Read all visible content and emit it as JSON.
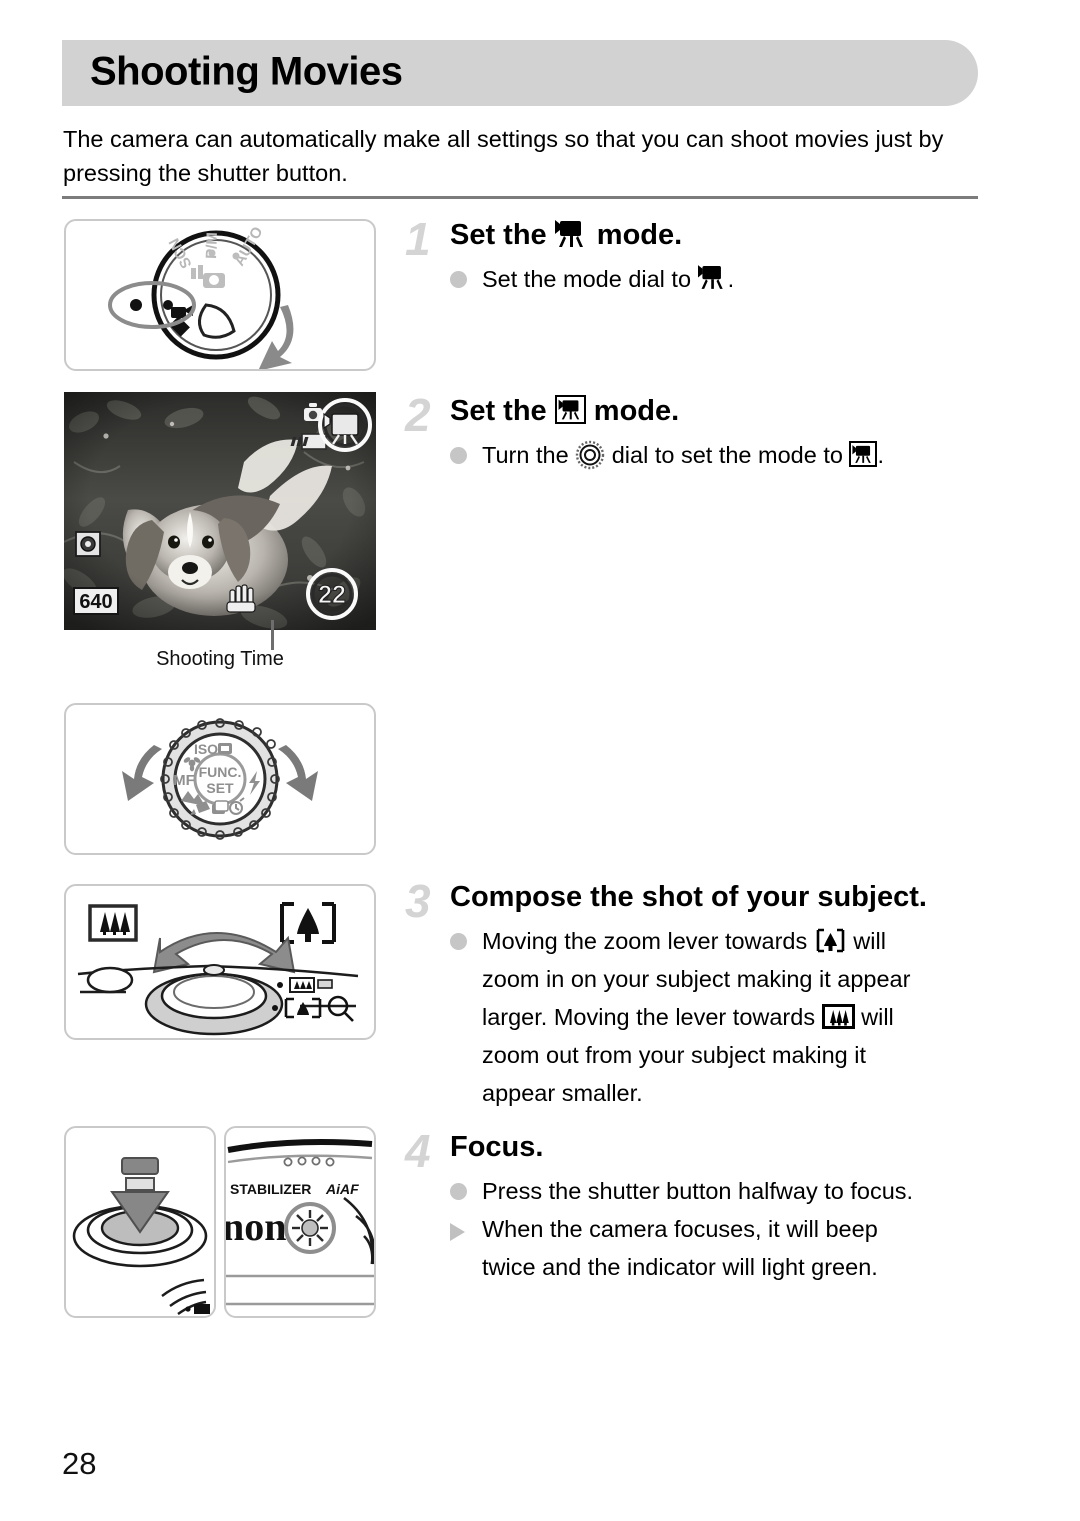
{
  "page": {
    "title": "Shooting Movies",
    "number": "28",
    "intro": "The camera can automatically make all settings so that you can shoot movies just by pressing the shutter button."
  },
  "figures": {
    "mode_dial": {
      "name": "mode-dial-illustration",
      "labels": [
        "AUTO",
        "P/M",
        "SCN"
      ],
      "highlight": "movie-mode-position"
    },
    "lcd": {
      "name": "lcd-preview",
      "caption": "Shooting Time",
      "overlays": {
        "resolution": "640",
        "shooting_time": "22",
        "mode_icon": "movie-mode-icon",
        "battery_icon": "battery-icon",
        "metering_icon": "metering-icon",
        "stabilizer_icon": "image-stabilizer-icon"
      }
    },
    "control_dial": {
      "name": "control-dial-illustration",
      "center_label_top": "FUNC.",
      "center_label_bottom": "SET",
      "labels": [
        "ISO",
        "MF"
      ]
    },
    "zoom_lever": {
      "name": "zoom-lever-illustration",
      "wide_icon": "wide-angle-icon",
      "tele_icon": "telephoto-icon"
    },
    "shutter": {
      "name": "shutter-button-illustration"
    },
    "af_lamp": {
      "name": "af-assist-lamp-illustration",
      "texts": [
        "STABILIZER",
        "AiAF",
        "non"
      ]
    }
  },
  "steps": [
    {
      "number": "1",
      "head_before": "Set the ",
      "head_icon": "movie-mode-icon",
      "head_after": " mode.",
      "lines": [
        {
          "marker": "dot",
          "before": "Set the mode dial to ",
          "icon": "movie-mode-icon",
          "after": "."
        }
      ]
    },
    {
      "number": "2",
      "head_before": "Set the ",
      "head_icon": "movie-mode-boxed-icon",
      "head_after": " mode.",
      "lines": [
        {
          "marker": "dot",
          "before": "Turn the ",
          "icon": "control-dial-icon",
          "mid": " dial to set the mode to ",
          "icon2": "movie-mode-boxed-icon",
          "after": "."
        }
      ]
    },
    {
      "number": "3",
      "head": "Compose the shot of your subject.",
      "lines": [
        {
          "marker": "dot",
          "before": "Moving the zoom lever towards ",
          "icon": "telephoto-icon",
          "after": " will"
        },
        {
          "marker": "none",
          "text": "zoom in on your subject making it appear"
        },
        {
          "marker": "none",
          "before": "larger. Moving the lever towards ",
          "icon": "wide-angle-icon",
          "after": " will"
        },
        {
          "marker": "none",
          "text": "zoom out from your subject making it"
        },
        {
          "marker": "none",
          "text": "appear smaller."
        }
      ]
    },
    {
      "number": "4",
      "head": "Focus.",
      "lines": [
        {
          "marker": "dot",
          "text": "Press the shutter button halfway to focus."
        },
        {
          "marker": "triangle",
          "text": "When the camera focuses, it will beep"
        },
        {
          "marker": "none",
          "text": "twice and the indicator will light green."
        }
      ]
    }
  ],
  "colors": {
    "header_bg": "#d2d2d2",
    "rule": "#7c7c7c",
    "step_number": "#d4d4d4",
    "bullet": "#c6c6c6",
    "panel_border": "#c9c9c9"
  }
}
